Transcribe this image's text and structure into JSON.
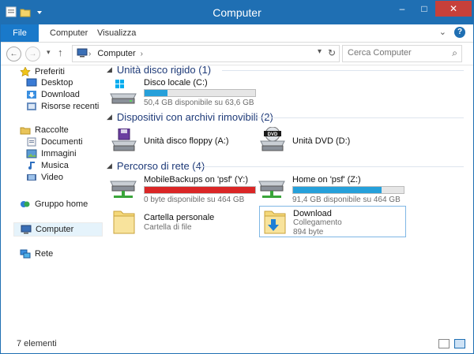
{
  "window": {
    "title": "Computer"
  },
  "titlebar_buttons": {
    "minimize": "–",
    "maximize": "□",
    "close": "✕"
  },
  "ribbon": {
    "tabs": [
      {
        "label": "File"
      },
      {
        "label": "Computer"
      },
      {
        "label": "Visualizza"
      }
    ],
    "collapse": "⌄",
    "help": "?"
  },
  "nav": {
    "back": "←",
    "forward": "→",
    "recent": "▾",
    "up": "↑",
    "address": "Computer",
    "address_sep": "›",
    "search_placeholder": "Cerca Computer"
  },
  "sidebar": {
    "favorites": "Preferiti",
    "fav_items": [
      {
        "label": "Desktop"
      },
      {
        "label": "Download"
      },
      {
        "label": "Risorse recenti"
      }
    ],
    "libraries": "Raccolte",
    "lib_items": [
      {
        "label": "Documenti"
      },
      {
        "label": "Immagini"
      },
      {
        "label": "Musica"
      },
      {
        "label": "Video"
      }
    ],
    "homegroup": "Gruppo home",
    "computer": "Computer",
    "network": "Rete"
  },
  "sections": {
    "hdd": "Unità disco rigido (1)",
    "removable": "Dispositivi con archivi rimovibili (2)",
    "network": "Percorso di rete (4)"
  },
  "drives": {
    "c": {
      "name": "Disco locale (C:)",
      "free": "50,4 GB disponibile su 63,6 GB",
      "used_fraction": 0.21,
      "bar_color": "#26a0da"
    },
    "floppy": {
      "name": "Unità disco floppy (A:)"
    },
    "dvd": {
      "name": "Unità DVD (D:)"
    },
    "y": {
      "name": "MobileBackups on 'psf' (Y:)",
      "free": "0 byte disponibile su 464 GB",
      "used_fraction": 1.0,
      "bar_color": "#da2626"
    },
    "z": {
      "name": "Home on 'psf' (Z:)",
      "free": "91,4 GB disponibile su 464 GB",
      "used_fraction": 0.8,
      "bar_color": "#26a0da"
    },
    "personal": {
      "name": "Cartella personale",
      "type": "Cartella di file"
    },
    "download": {
      "name": "Download",
      "type": "Collegamento",
      "size": "894 byte"
    }
  },
  "status": {
    "count": "7 elementi"
  }
}
